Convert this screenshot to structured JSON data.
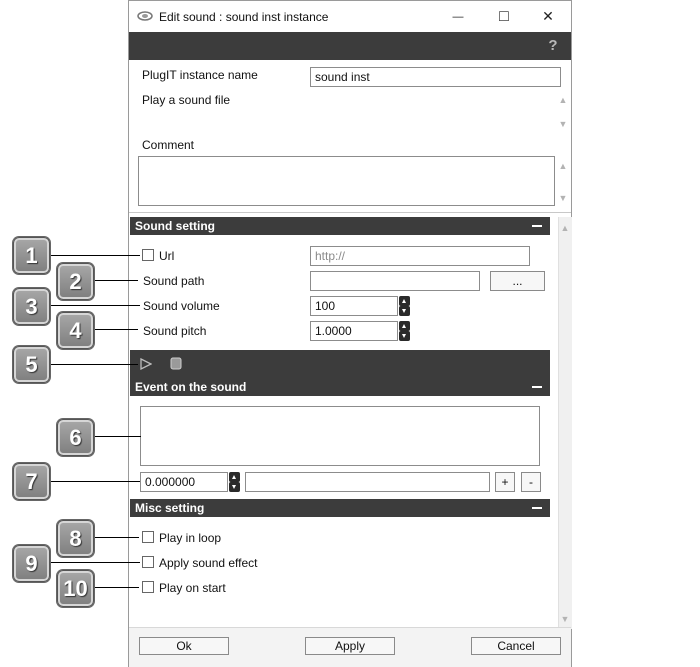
{
  "window": {
    "title": "Edit sound : sound inst instance",
    "minimize": "—",
    "maximize": "□",
    "close": "✕"
  },
  "toolbar": {
    "help_icon": "help-icon",
    "help": "?"
  },
  "header_fields": {
    "instance_label": "PlugIT instance name",
    "instance_value": "sound inst",
    "description": "Play a sound file",
    "comment_label": "Comment"
  },
  "sound_setting": {
    "title": "Sound setting",
    "url_label": "Url",
    "url_placeholder": "http://",
    "path_label": "Sound path",
    "browse": "...",
    "volume_label": "Sound volume",
    "volume_value": "100",
    "pitch_label": "Sound pitch",
    "pitch_value": "1.0000"
  },
  "player": {
    "play_icon": "play-icon",
    "stop_icon": "stop-icon"
  },
  "event_section": {
    "title": "Event on the sound",
    "time_value": "0.000000",
    "add": "+",
    "remove": "-"
  },
  "misc_setting": {
    "title": "Misc setting",
    "loop_label": "Play in loop",
    "effect_label": "Apply sound effect",
    "start_label": "Play on start"
  },
  "footer": {
    "ok": "Ok",
    "apply": "Apply",
    "cancel": "Cancel"
  },
  "callouts": [
    "1",
    "2",
    "3",
    "4",
    "5",
    "6",
    "7",
    "8",
    "9",
    "10"
  ]
}
